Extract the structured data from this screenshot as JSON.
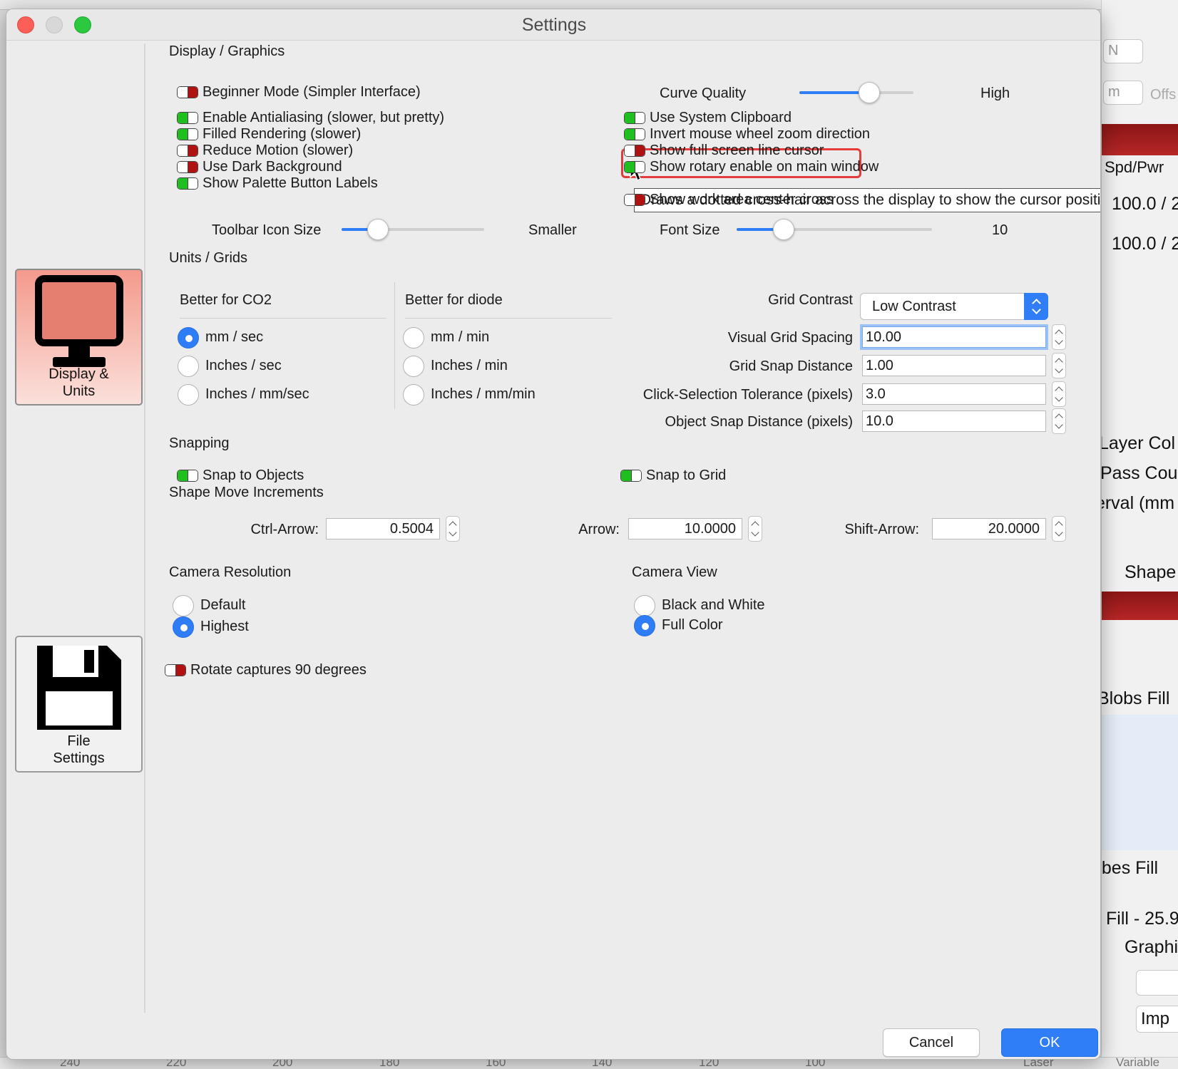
{
  "window": {
    "title": "Settings"
  },
  "sidebar": {
    "display_units": "Display &\nUnits",
    "file_settings": "File\nSettings"
  },
  "display": {
    "section": "Display / Graphics",
    "left_toggles": [
      {
        "label": "Beginner Mode (Simpler Interface)",
        "on": false
      },
      {
        "label": "Enable Antialiasing (slower, but pretty)",
        "on": true
      },
      {
        "label": "Filled Rendering (slower)",
        "on": true
      },
      {
        "label": "Reduce Motion (slower)",
        "on": false
      },
      {
        "label": "Use Dark Background",
        "on": false
      },
      {
        "label": "Show Palette Button Labels",
        "on": true
      }
    ],
    "right_toggles": [
      {
        "label": "Use System Clipboard",
        "on": true
      },
      {
        "label": "Invert mouse wheel zoom direction",
        "on": true
      },
      {
        "label": "Show full screen line cursor",
        "on": false
      },
      {
        "label": "Show rotary enable on main window",
        "on": true
      },
      {
        "label": "Show work area center cross",
        "on": false
      }
    ],
    "curve_quality": {
      "label": "Curve Quality",
      "value_label": "High",
      "level": 0.64
    },
    "toolbar_icon_size": {
      "label": "Toolbar Icon Size",
      "value_label": "Smaller",
      "level": 0.21
    },
    "font_size": {
      "label": "Font Size",
      "value_label": "10",
      "level": 0.21
    },
    "tooltip": "Draws a dotted cross-hair across the display to show the cursor position"
  },
  "units": {
    "section": "Units / Grids",
    "co2_header": "Better for CO2",
    "diode_header": "Better for diode",
    "co2_options": [
      "mm / sec",
      "Inches / sec",
      "Inches / mm/sec"
    ],
    "co2_selected": 0,
    "diode_options": [
      "mm / min",
      "Inches / min",
      "Inches / mm/min"
    ],
    "grid_contrast": {
      "label": "Grid Contrast",
      "value": "Low Contrast"
    },
    "visual_grid_spacing": {
      "label": "Visual Grid Spacing",
      "value": "10.00"
    },
    "grid_snap_distance": {
      "label": "Grid Snap Distance",
      "value": "1.00"
    },
    "click_tolerance": {
      "label": "Click-Selection Tolerance (pixels)",
      "value": "3.0"
    },
    "object_snap_distance": {
      "label": "Object Snap Distance (pixels)",
      "value": "10.0"
    }
  },
  "snapping": {
    "section": "Snapping",
    "snap_objects": {
      "label": "Snap to Objects",
      "on": true
    },
    "snap_grid": {
      "label": "Snap to Grid",
      "on": true
    }
  },
  "increments": {
    "section": "Shape Move Increments",
    "ctrl_arrow": {
      "label": "Ctrl-Arrow:",
      "value": "0.5004"
    },
    "arrow": {
      "label": "Arrow:",
      "value": "10.0000"
    },
    "shift_arrow": {
      "label": "Shift-Arrow:",
      "value": "20.0000"
    }
  },
  "camera": {
    "resolution_section": "Camera Resolution",
    "resolution_options": [
      "Default",
      "Highest"
    ],
    "view_section": "Camera View",
    "view_options": [
      "Black and White",
      "Full Color"
    ],
    "rotate": {
      "label": "Rotate captures 90 degrees",
      "on": false
    }
  },
  "buttons": {
    "cancel": "Cancel",
    "ok": "OK"
  },
  "background": {
    "right_texts": [
      "Spd/Pwr",
      "100.0 / 2",
      "100.0 / 2",
      "Layer Col",
      "Pass Cou",
      "terval (mm",
      "Shape",
      "Blobs Fill",
      "ubes Fill",
      "Fill - 25.9",
      "Graphi",
      "Imp"
    ],
    "spin_texts": [
      "N",
      "m",
      "Offs"
    ],
    "ruler": [
      "240",
      "220",
      "200",
      "180",
      "160",
      "140",
      "120",
      "100"
    ],
    "bottom_right": [
      "Laser",
      "Variable"
    ]
  },
  "colors": {
    "accent": "#2f7df7",
    "toggle_on": "#1fbf1f",
    "toggle_off": "#b01212",
    "highlight": "#e53b3b"
  }
}
